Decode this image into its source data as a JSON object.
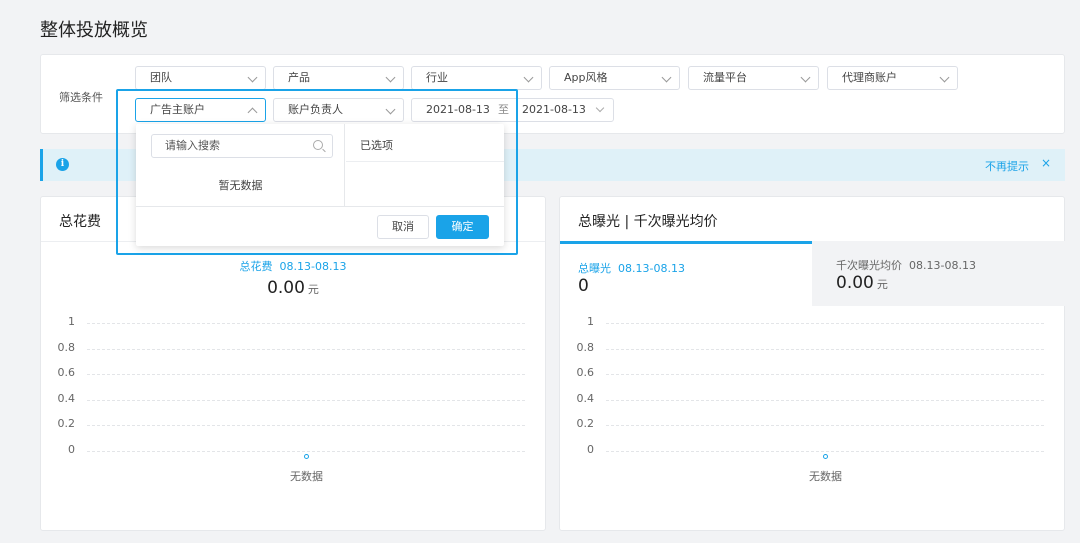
{
  "page": {
    "title": "整体投放概览"
  },
  "filters": {
    "label": "筛选条件",
    "row1": [
      "团队",
      "产品",
      "行业",
      "App风格",
      "流量平台",
      "代理商账户"
    ],
    "advertiser_account": "广告主账户",
    "account_owner": "账户负责人",
    "date_start": "2021-08-13",
    "date_sep": "至",
    "date_end": "2021-08-13"
  },
  "dropdown": {
    "search_placeholder": "请输入搜索",
    "empty_text": "暂无数据",
    "selected_title": "已选项",
    "cancel_label": "取消",
    "confirm_label": "确定"
  },
  "info_bar": {
    "icon": "info-icon",
    "dismiss_label": "不再提示",
    "close_glyph": "×"
  },
  "spend_card": {
    "title": "总花费",
    "metric_label": "总花费",
    "metric_range": "08.13-08.13",
    "value": "0.00",
    "unit": "元",
    "empty_text": "无数据"
  },
  "exposure_card": {
    "title": "总曝光 | 千次曝光均价",
    "tabs": [
      {
        "label": "总曝光",
        "range": "08.13-08.13",
        "value": "0",
        "unit": ""
      },
      {
        "label": "千次曝光均价",
        "range": "08.13-08.13",
        "value": "0.00",
        "unit": "元"
      }
    ],
    "empty_text": "无数据"
  },
  "chart_data": [
    {
      "type": "line",
      "series": [],
      "y_ticks": [
        "1",
        "0.8",
        "0.6",
        "0.4",
        "0.2",
        "0"
      ],
      "ylim": [
        0,
        1
      ],
      "grid": true,
      "empty_text": "无数据"
    },
    {
      "type": "line",
      "series": [],
      "y_ticks": [
        "1",
        "0.8",
        "0.6",
        "0.4",
        "0.2",
        "0"
      ],
      "ylim": [
        0,
        1
      ],
      "grid": true,
      "empty_text": "无数据"
    }
  ],
  "colors": {
    "accent": "#1aa3e8",
    "info_bg": "#dff1f8"
  }
}
